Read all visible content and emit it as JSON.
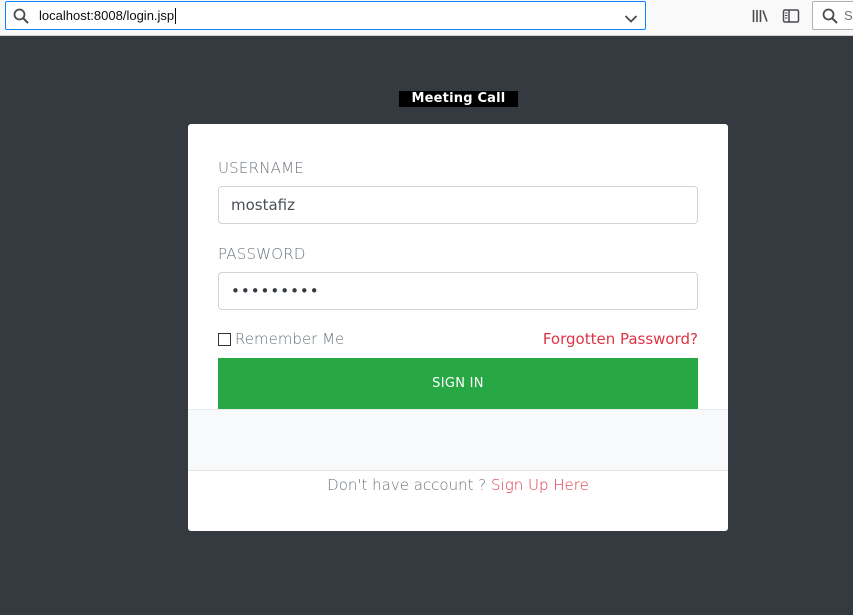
{
  "browser": {
    "url": "localhost:8008/login.jsp",
    "search_placeholder": "Se",
    "icons": [
      "search-icon",
      "dropdown-chevron-icon",
      "library-icon",
      "sidebar-icon"
    ]
  },
  "brand": {
    "logo_text": "Meeting Call"
  },
  "login": {
    "username_label": "USERNAME",
    "username_value": "mostafiz",
    "password_label": "PASSWORD",
    "password_value": "•••••••••",
    "remember_label": "Remember Me",
    "remember_checked": false,
    "forgot_label": "Forgotten Password?",
    "signin_label": "SIGN IN",
    "signup_prompt": "Don't have account ?",
    "signup_link": "Sign Up Here"
  },
  "colors": {
    "page_bg": "#343a40",
    "primary_green": "#28a745",
    "link_red": "#dc3545",
    "url_focus": "#0a84ff"
  }
}
